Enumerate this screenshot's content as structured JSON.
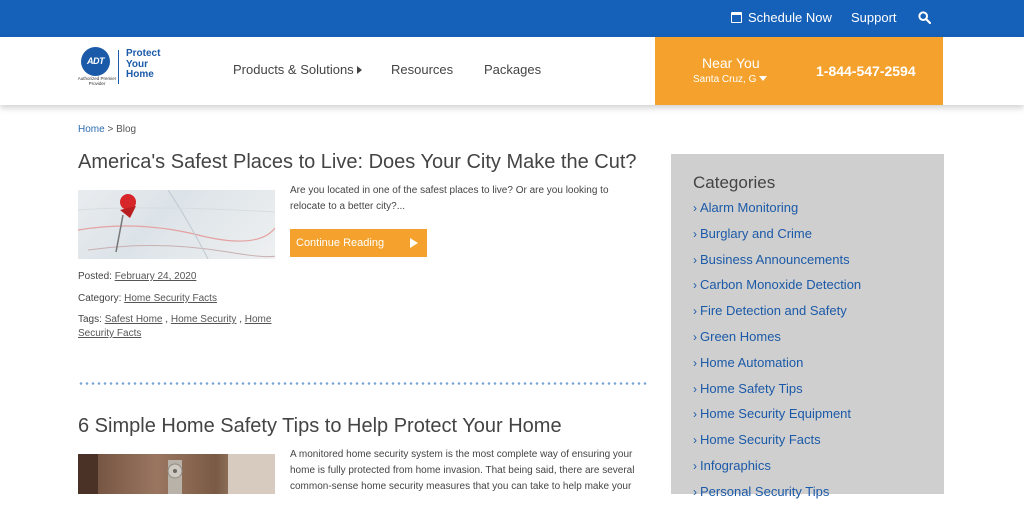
{
  "topbar": {
    "schedule_label": "Schedule Now",
    "support_label": "Support",
    "search_icon": "search-icon"
  },
  "logo": {
    "adt_text": "ADT",
    "authorized_text": "Authorized Premier Provider",
    "brand_text": "Protect Your Home"
  },
  "nav": {
    "products": "Products & Solutions",
    "resources": "Resources",
    "packages": "Packages"
  },
  "location": {
    "label": "Near You",
    "city": "Santa Cruz, G",
    "phone": "1-844-547-2594"
  },
  "breadcrumb": {
    "home": "Home",
    "separator": " > ",
    "current": "Blog"
  },
  "posts": [
    {
      "title": "America's Safest Places to Live: Does Your City Make the Cut?",
      "excerpt": "Are you located in one of the safest places to live? Or are you looking to relocate to a better city?...",
      "button": "Continue Reading",
      "posted_label": "Posted:",
      "date": "February 24, 2020",
      "category_label": "Category:",
      "category": "Home Security Facts",
      "tags_label": "Tags:",
      "tags": [
        "Safest Home",
        "Home Security",
        "Home Security Facts"
      ],
      "tag_separator": " , "
    },
    {
      "title": "6 Simple Home Safety Tips to Help Protect Your Home",
      "excerpt": "A monitored home security system is the most complete way of ensuring your home is fully protected from home invasion. That being said, there are several common-sense home security measures that you can take to help make your"
    }
  ],
  "sidebar": {
    "title": "Categories",
    "chevron": "›",
    "items": [
      "Alarm Monitoring",
      "Burglary and Crime",
      "Business Announcements",
      "Carbon Monoxide Detection",
      "Fire Detection and Safety",
      "Green Homes",
      "Home Automation",
      "Home Safety Tips",
      "Home Security Equipment",
      "Home Security Facts",
      "Infographics",
      "Personal Security Tips"
    ]
  },
  "colors": {
    "topbar": "#1560b8",
    "accent_orange": "#f4a22d",
    "link_blue": "#1b5aa8",
    "sidebar_bg": "#cfcfcf"
  }
}
